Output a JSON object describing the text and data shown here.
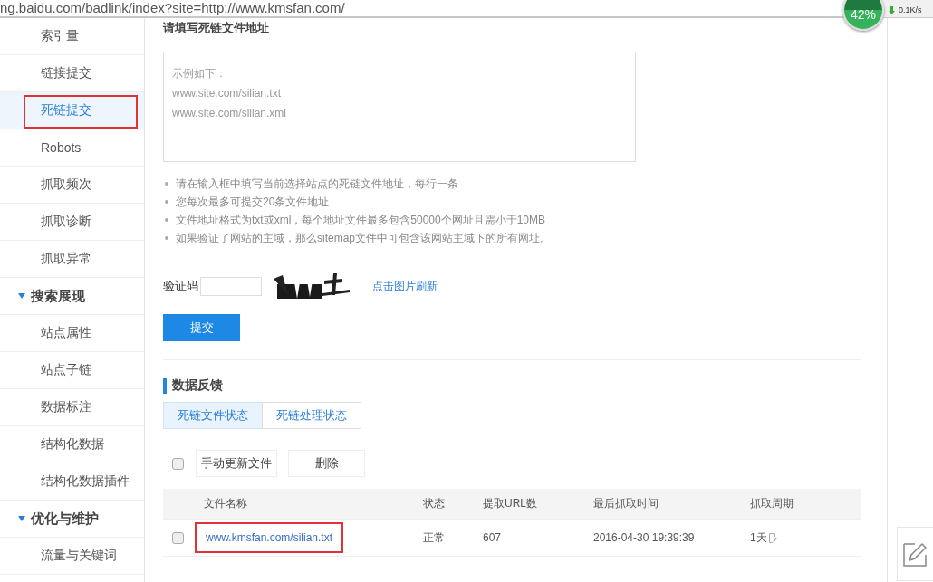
{
  "address_bar": {
    "url": "ng.baidu.com/badlink/index?site=http://www.kmsfan.com/"
  },
  "net_widget": {
    "percent": "42%",
    "download": "0.1K/s"
  },
  "sidebar": {
    "items": [
      {
        "kind": "item",
        "label": "索引量",
        "selected": false,
        "highlighted": false
      },
      {
        "kind": "item",
        "label": "链接提交",
        "selected": false,
        "highlighted": false
      },
      {
        "kind": "item",
        "label": "死链提交",
        "selected": true,
        "highlighted": true
      },
      {
        "kind": "item",
        "label": "Robots",
        "selected": false,
        "highlighted": false
      },
      {
        "kind": "item",
        "label": "抓取频次",
        "selected": false,
        "highlighted": false
      },
      {
        "kind": "item",
        "label": "抓取诊断",
        "selected": false,
        "highlighted": false
      },
      {
        "kind": "item",
        "label": "抓取异常",
        "selected": false,
        "highlighted": false
      },
      {
        "kind": "group",
        "label": "搜索展现",
        "selected": false,
        "highlighted": false
      },
      {
        "kind": "item",
        "label": "站点属性",
        "selected": false,
        "highlighted": false
      },
      {
        "kind": "item",
        "label": "站点子链",
        "selected": false,
        "highlighted": false
      },
      {
        "kind": "item",
        "label": "数据标注",
        "selected": false,
        "highlighted": false
      },
      {
        "kind": "item",
        "label": "结构化数据",
        "selected": false,
        "highlighted": false
      },
      {
        "kind": "item",
        "label": "结构化数据插件",
        "selected": false,
        "highlighted": false
      },
      {
        "kind": "group",
        "label": "优化与维护",
        "selected": false,
        "highlighted": false
      },
      {
        "kind": "item",
        "label": "流量与关键词",
        "selected": false,
        "highlighted": false
      }
    ]
  },
  "form": {
    "title": "请填写死链文件地址",
    "textarea": {
      "placeholder": "示例如下：\nwww.site.com/silian.txt\nwww.site.com/silian.xml"
    },
    "notes": [
      "请在输入框中填写当前选择站点的死链文件地址，每行一条",
      "您每次最多可提交20条文件地址",
      "文件地址格式为txt或xml，每个地址文件最多包含50000个网址且需小于10MB",
      "如果验证了网站的主域，那么sitemap文件中可包含该网站主域下的所有网址。"
    ],
    "captcha_label": "验证码",
    "captcha_refresh": "点击图片刷新",
    "submit": "提交"
  },
  "feedback": {
    "title": "数据反馈",
    "tabs": [
      {
        "label": "死链文件状态",
        "selected": true
      },
      {
        "label": "死链处理状态",
        "selected": false
      }
    ],
    "toolbar": {
      "select_all_checked": false,
      "buttons": [
        "手动更新文件",
        "删除"
      ]
    },
    "table": {
      "columns": [
        "文件名称",
        "状态",
        "提取URL数",
        "最后抓取时间",
        "抓取周期"
      ],
      "rows": [
        {
          "checked": false,
          "file": "www.kmsfan.com/silian.txt",
          "highlighted": true,
          "status": "正常",
          "url_count": "607",
          "last_fetch": "2016-04-30 19:39:39",
          "cycle": "1天"
        }
      ]
    }
  }
}
